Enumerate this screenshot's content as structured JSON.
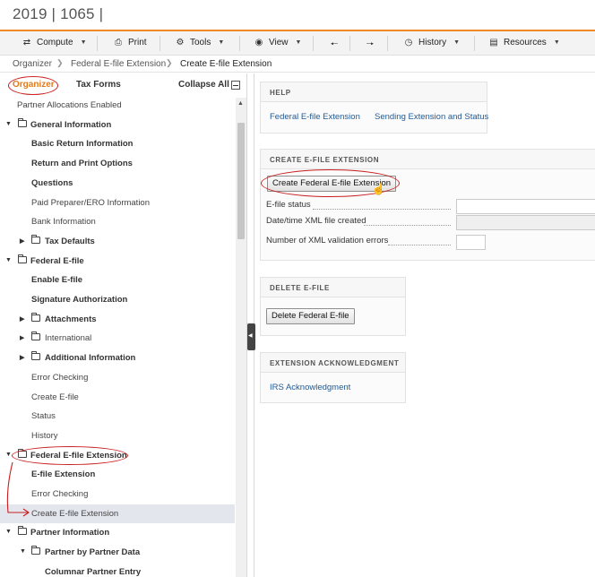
{
  "app": {
    "title": "2019 | 1065 |"
  },
  "toolbar": {
    "items": [
      {
        "label": "Compute",
        "icon": "compute-icon",
        "has_dropdown": true
      },
      {
        "label": "Print",
        "icon": "print-icon",
        "has_dropdown": false
      },
      {
        "label": "Tools",
        "icon": "gear-icon",
        "has_dropdown": true
      },
      {
        "label": "View",
        "icon": "eye-icon",
        "has_dropdown": true
      },
      {
        "label": "",
        "icon": "arrow-left-icon",
        "has_dropdown": false
      },
      {
        "label": "",
        "icon": "arrow-right-icon",
        "has_dropdown": false
      },
      {
        "label": "History",
        "icon": "history-icon",
        "has_dropdown": true
      },
      {
        "label": "Resources",
        "icon": "resources-icon",
        "has_dropdown": true
      }
    ]
  },
  "breadcrumb": [
    "Organizer",
    "Federal E-file Extension",
    "Create E-file Extension"
  ],
  "sidebar": {
    "tabs": [
      {
        "label": "Organizer",
        "active": true
      },
      {
        "label": "Tax Forms",
        "active": false
      }
    ],
    "collapse_label": "Collapse All",
    "tree": [
      {
        "label": "Partner Allocations Enabled",
        "level": 1,
        "bold": false,
        "folder": false,
        "expander": ""
      },
      {
        "label": "General Information",
        "level": 0,
        "bold": true,
        "folder": true,
        "expander": "open"
      },
      {
        "label": "Basic Return Information",
        "level": 1,
        "bold": true,
        "folder": false,
        "expander": ""
      },
      {
        "label": "Return and Print Options",
        "level": 1,
        "bold": true,
        "folder": false,
        "expander": ""
      },
      {
        "label": "Questions",
        "level": 1,
        "bold": true,
        "folder": false,
        "expander": ""
      },
      {
        "label": "Paid Preparer/ERO Information",
        "level": 1,
        "bold": false,
        "folder": false,
        "expander": ""
      },
      {
        "label": "Bank Information",
        "level": 1,
        "bold": false,
        "folder": false,
        "expander": ""
      },
      {
        "label": "Tax Defaults",
        "level": 1,
        "bold": true,
        "folder": true,
        "expander": "closed"
      },
      {
        "label": "Federal E-file",
        "level": 0,
        "bold": true,
        "folder": true,
        "expander": "open"
      },
      {
        "label": "Enable E-file",
        "level": 1,
        "bold": true,
        "folder": false,
        "expander": ""
      },
      {
        "label": "Signature Authorization",
        "level": 1,
        "bold": true,
        "folder": false,
        "expander": ""
      },
      {
        "label": "Attachments",
        "level": 1,
        "bold": true,
        "folder": true,
        "expander": "closed"
      },
      {
        "label": "International",
        "level": 1,
        "bold": false,
        "folder": true,
        "expander": "closed"
      },
      {
        "label": "Additional Information",
        "level": 1,
        "bold": true,
        "folder": true,
        "expander": "closed"
      },
      {
        "label": "Error Checking",
        "level": 1,
        "bold": false,
        "folder": false,
        "expander": ""
      },
      {
        "label": "Create E-file",
        "level": 1,
        "bold": false,
        "folder": false,
        "expander": ""
      },
      {
        "label": "Status",
        "level": 1,
        "bold": false,
        "folder": false,
        "expander": ""
      },
      {
        "label": "History",
        "level": 1,
        "bold": false,
        "folder": false,
        "expander": ""
      },
      {
        "label": "Federal E-file Extension",
        "level": 0,
        "bold": true,
        "folder": true,
        "expander": "open"
      },
      {
        "label": "E-file Extension",
        "level": 1,
        "bold": true,
        "folder": false,
        "expander": ""
      },
      {
        "label": "Error Checking",
        "level": 1,
        "bold": false,
        "folder": false,
        "expander": ""
      },
      {
        "label": "Create E-file Extension",
        "level": 1,
        "bold": false,
        "folder": false,
        "expander": "",
        "selected": true
      },
      {
        "label": "Partner Information",
        "level": 0,
        "bold": true,
        "folder": true,
        "expander": "open"
      },
      {
        "label": "Partner by Partner Data",
        "level": 1,
        "bold": true,
        "folder": true,
        "expander": "open"
      },
      {
        "label": "Columnar Partner Entry",
        "level": 2,
        "bold": true,
        "folder": false,
        "expander": ""
      }
    ]
  },
  "main": {
    "help": {
      "title": "HELP",
      "links": [
        "Federal E-file Extension",
        "Sending Extension and Status"
      ]
    },
    "create": {
      "title": "CREATE E-FILE EXTENSION",
      "button": "Create Federal E-file Extension",
      "fields": [
        {
          "label": "E-file status",
          "value": ""
        },
        {
          "label": "Date/time XML file created",
          "value": ""
        },
        {
          "label": "Number of XML validation errors",
          "value": ""
        }
      ]
    },
    "delete": {
      "title": "DELETE E-FILE",
      "button": "Delete Federal E-file"
    },
    "ack": {
      "title": "EXTENSION ACKNOWLEDGMENT",
      "link": "IRS Acknowledgment"
    }
  },
  "colors": {
    "accent": "#f08a24",
    "annotation": "#c81e1e",
    "link": "#1f5a96"
  }
}
